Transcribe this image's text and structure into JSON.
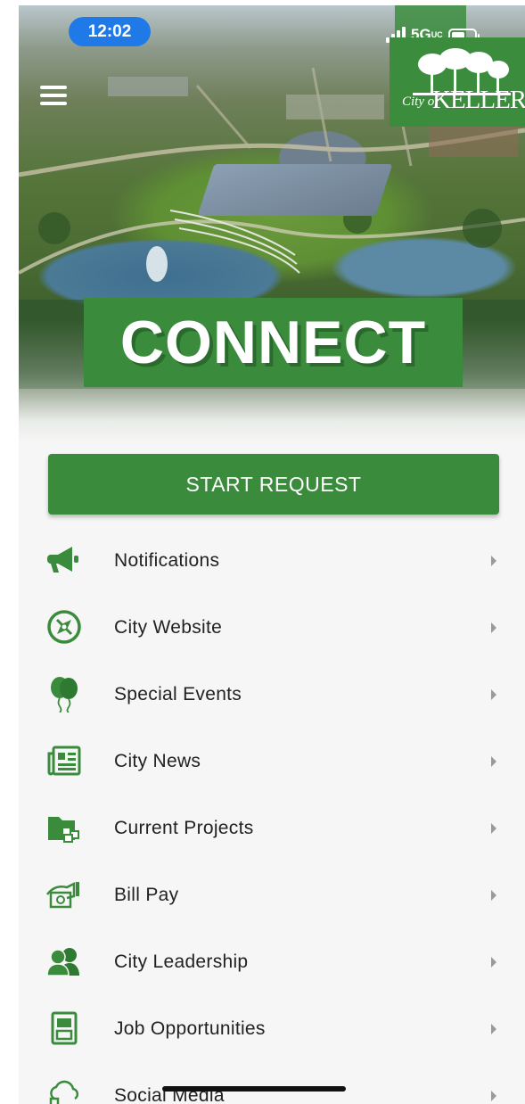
{
  "status_bar": {
    "time": "12:02",
    "network": "5G",
    "network_suffix": "UC"
  },
  "hero": {
    "logo": {
      "small_text": "City of",
      "large_text": "KELLER"
    },
    "banner_text": "CONNECT"
  },
  "colors": {
    "brand_green": "#3b8b3d",
    "status_pill_blue": "#1f7ae8",
    "list_background": "#f6f6f6"
  },
  "start_request_label": "START REQUEST",
  "menu": [
    {
      "label": "Notifications",
      "icon": "megaphone-icon"
    },
    {
      "label": "City Website",
      "icon": "compass-icon"
    },
    {
      "label": "Special Events",
      "icon": "balloons-icon"
    },
    {
      "label": "City News",
      "icon": "newspaper-icon"
    },
    {
      "label": "Current Projects",
      "icon": "folder-blocks-icon"
    },
    {
      "label": "Bill Pay",
      "icon": "hand-money-icon"
    },
    {
      "label": "City Leadership",
      "icon": "people-icon"
    },
    {
      "label": "Job Opportunities",
      "icon": "job-board-icon"
    },
    {
      "label": "Social Media",
      "icon": "cloud-share-icon"
    }
  ]
}
